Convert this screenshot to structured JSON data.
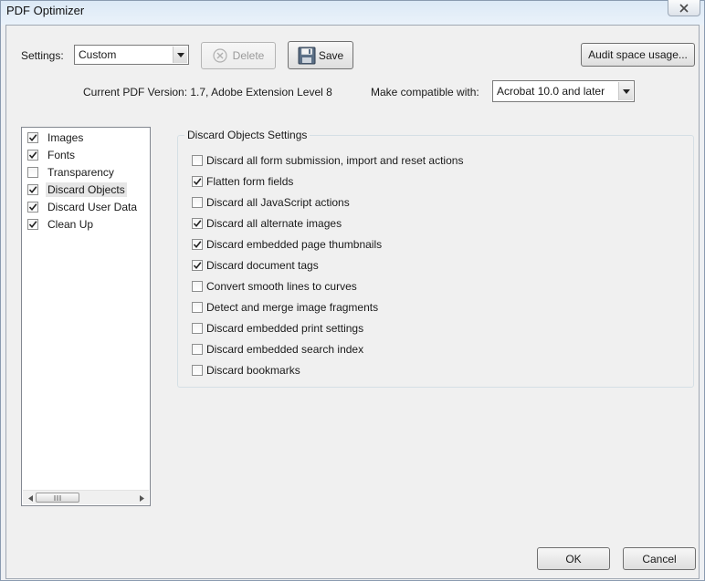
{
  "window": {
    "title": "PDF Optimizer"
  },
  "settings": {
    "label": "Settings:",
    "value": "Custom",
    "delete_label": "Delete",
    "save_label": "Save",
    "audit_label": "Audit space usage..."
  },
  "version": {
    "current_text": "Current PDF Version: 1.7, Adobe Extension Level 8",
    "compat_label": "Make compatible with:",
    "compat_value": "Acrobat 10.0 and later"
  },
  "panels": [
    {
      "label": "Images",
      "checked": true,
      "selected": false
    },
    {
      "label": "Fonts",
      "checked": true,
      "selected": false
    },
    {
      "label": "Transparency",
      "checked": false,
      "selected": false
    },
    {
      "label": "Discard Objects",
      "checked": true,
      "selected": true
    },
    {
      "label": "Discard User Data",
      "checked": true,
      "selected": false
    },
    {
      "label": "Clean Up",
      "checked": true,
      "selected": false
    }
  ],
  "group": {
    "title": "Discard Objects Settings",
    "options": [
      {
        "label": "Discard all form submission, import and reset actions",
        "checked": false
      },
      {
        "label": "Flatten form fields",
        "checked": true
      },
      {
        "label": "Discard all JavaScript actions",
        "checked": false
      },
      {
        "label": "Discard all alternate images",
        "checked": true
      },
      {
        "label": "Discard embedded page thumbnails",
        "checked": true
      },
      {
        "label": "Discard document tags",
        "checked": true
      },
      {
        "label": "Convert smooth lines to curves",
        "checked": false
      },
      {
        "label": "Detect and merge image fragments",
        "checked": false
      },
      {
        "label": "Discard embedded print settings",
        "checked": false
      },
      {
        "label": "Discard embedded search index",
        "checked": false
      },
      {
        "label": "Discard bookmarks",
        "checked": false
      }
    ]
  },
  "footer": {
    "ok_label": "OK",
    "cancel_label": "Cancel"
  },
  "icons": {
    "close": "close-icon",
    "delete": "delete-icon",
    "save": "floppy-disk-icon",
    "dropdown": "chevron-down-icon",
    "check": "check-icon"
  }
}
